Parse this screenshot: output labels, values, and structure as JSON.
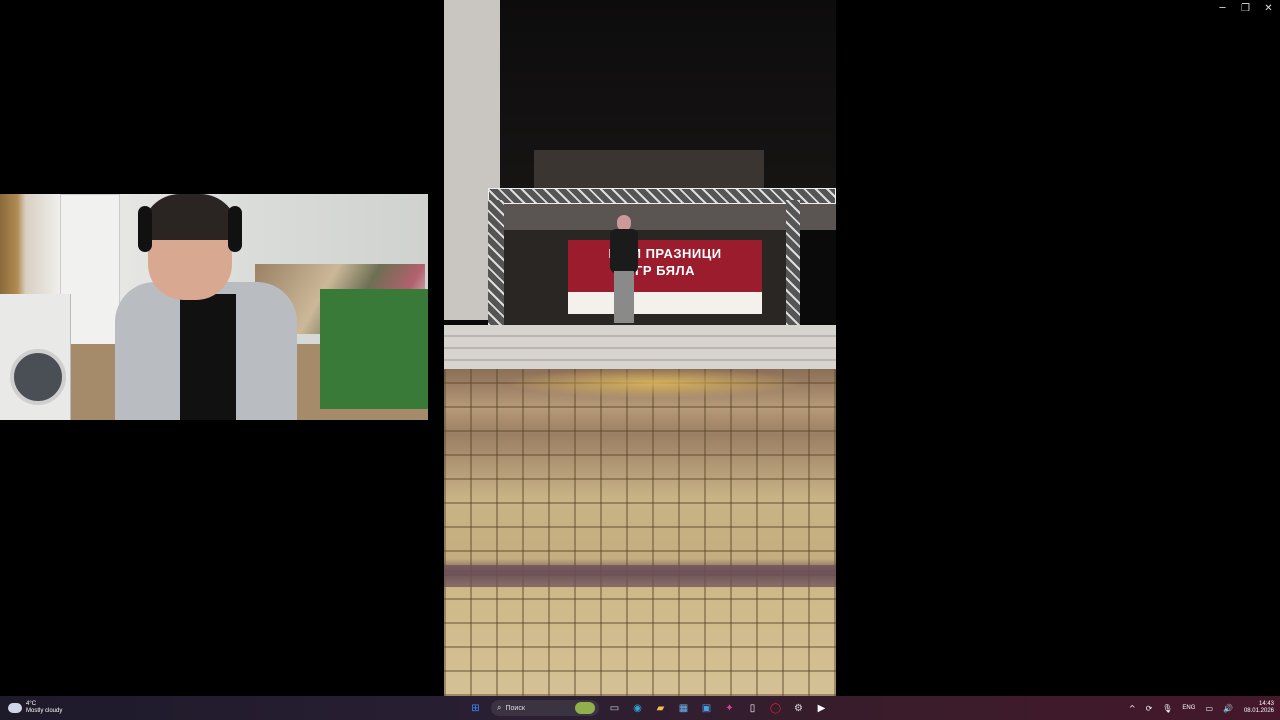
{
  "window": {
    "minimize": "─",
    "restore": "❐",
    "close": "✕"
  },
  "video": {
    "banner_line1": "КО    И ПРАЗНИЦИ",
    "banner_line2": "ГР БЯЛА"
  },
  "taskbar": {
    "weather": {
      "temp": "4°C",
      "condition": "Mostly cloudy",
      "icon": "partly-cloudy-icon"
    },
    "search_placeholder": "Поиск",
    "pinned": [
      {
        "name": "windows-start-icon",
        "glyph": "⊞",
        "color": "#3d8bfd"
      },
      {
        "name": "task-view-icon",
        "glyph": "▭",
        "color": "#cfcfcf"
      },
      {
        "name": "edge-icon",
        "glyph": "◉",
        "color": "#2aa7d8"
      },
      {
        "name": "file-explorer-icon",
        "glyph": "▰",
        "color": "#f0c24a"
      },
      {
        "name": "store-icon",
        "glyph": "▦",
        "color": "#6fb3f0"
      },
      {
        "name": "app-icon",
        "glyph": "▣",
        "color": "#4aa0e8"
      },
      {
        "name": "copilot-icon",
        "glyph": "✦",
        "color": "#e0409a"
      },
      {
        "name": "document-icon",
        "glyph": "▯",
        "color": "#f2f2f2"
      },
      {
        "name": "opera-icon",
        "glyph": "◯",
        "color": "#e8202a"
      },
      {
        "name": "settings-icon",
        "glyph": "⚙",
        "color": "#dddddd"
      },
      {
        "name": "media-player-icon",
        "glyph": "▶",
        "color": "#ffffff"
      }
    ],
    "tray": {
      "chevron": "^",
      "lang": "ENG",
      "time": "14:43",
      "date": "08.01.2026"
    }
  }
}
